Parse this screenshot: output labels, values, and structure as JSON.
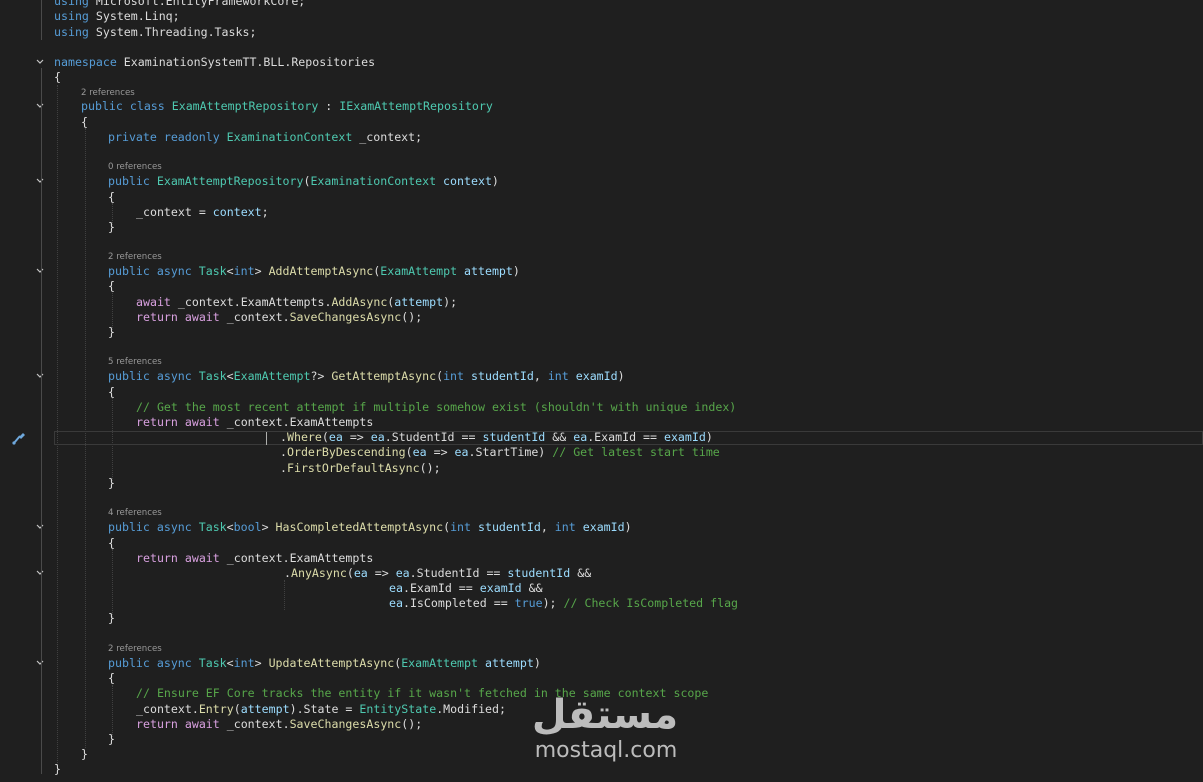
{
  "editor": {
    "theme": {
      "background": "#1f1f1f",
      "keyword": "#569cd6",
      "control": "#d8a0df",
      "type": "#4ec9b0",
      "method": "#dcdcaa",
      "parameter": "#9cdcfe",
      "comment": "#57a64a",
      "text": "#dcdcdc",
      "codelens": "#999999"
    },
    "code": {
      "using1": {
        "kw": "using",
        "ns": " Microsoft.EntityFrameworkCore;"
      },
      "using2": {
        "kw": "using",
        "ns": " System.Linq;"
      },
      "using3": {
        "kw": "using",
        "ns": " System.Threading.Tasks;"
      },
      "namespace": {
        "kw": "namespace",
        "name": " ExaminationSystemTT.BLL.Repositories"
      },
      "brace_open": "{",
      "brace_close": "}",
      "lens_class": "2 references",
      "class_decl": {
        "kw": "public class",
        "name": " ExamAttemptRepository",
        "sep": " : ",
        "iface": "IExamAttemptRepository"
      },
      "field": {
        "kw": "private readonly",
        "type": " ExaminationContext",
        "rest": " _context;"
      },
      "lens_ctor": "0 references",
      "ctor": {
        "kw": "public",
        "name": " ExamAttemptRepository",
        "open": "(",
        "ptype": "ExaminationContext",
        "pname": " context",
        "close": ")"
      },
      "ctor_body": {
        "lhs": "_context = ",
        "rhs": "context",
        "end": ";"
      },
      "lens_add": "2 references",
      "add_sig": {
        "kw": "public async",
        "task": " Task",
        "lt": "<",
        "generic": "int",
        "gt": "> ",
        "name": "AddAttemptAsync",
        "open": "(",
        "ptype": "ExamAttempt",
        "pname": " attempt",
        "close": ")"
      },
      "add_l1": {
        "kw": "await",
        "a": " _context.ExamAttempts.",
        "m": "AddAsync",
        "b": "(",
        "p": "attempt",
        "c": ");"
      },
      "add_l2": {
        "kw": "return await",
        "a": " _context.",
        "m": "SaveChangesAsync",
        "c": "();"
      },
      "lens_get": "5 references",
      "get_sig": {
        "kw": "public async",
        "task": " Task",
        "lt": "<",
        "generic": "ExamAttempt",
        "gt": "?> ",
        "name": "GetAttemptAsync",
        "open": "(",
        "t1": "int",
        "p1": " studentId",
        "comma": ", ",
        "t2": "int",
        "p2": " examId",
        "close": ")"
      },
      "get_comment": "// Get the most recent attempt if multiple somehow exist (shouldn't with unique index)",
      "get_l1": {
        "kw": "return await",
        "a": " _context.ExamAttempts"
      },
      "get_l2": {
        "dot": ".",
        "m": "Where",
        "a": "(",
        "p1": "ea",
        "b": " => ",
        "p2": "ea",
        "c": ".StudentId == ",
        "p3": "studentId",
        "d": " && ",
        "p4": "ea",
        "e": ".ExamId == ",
        "p5": "examId",
        "f": ")"
      },
      "get_l3": {
        "dot": ".",
        "m": "OrderByDescending",
        "a": "(",
        "p1": "ea",
        "b": " => ",
        "p2": "ea",
        "c": ".StartTime) ",
        "cm": "// Get latest start time"
      },
      "get_l4": {
        "dot": ".",
        "m": "FirstOrDefaultAsync",
        "c": "();"
      },
      "lens_has": "4 references",
      "has_sig": {
        "kw": "public async",
        "task": " Task",
        "lt": "<",
        "generic": "bool",
        "gt": "> ",
        "name": "HasCompletedAttemptAsync",
        "open": "(",
        "t1": "int",
        "p1": " studentId",
        "comma": ", ",
        "t2": "int",
        "p2": " examId",
        "close": ")"
      },
      "has_l1": {
        "kw": "return await",
        "a": " _context.ExamAttempts"
      },
      "has_l2": {
        "dot": ".",
        "m": "AnyAsync",
        "a": "(",
        "p1": "ea",
        "b": " => ",
        "p2": "ea",
        "c": ".StudentId == ",
        "p3": "studentId",
        "d": " &&"
      },
      "has_l3": {
        "p1": "ea",
        "c": ".ExamId == ",
        "p2": "examId",
        "d": " &&"
      },
      "has_l4": {
        "p1": "ea",
        "c": ".IsCompleted == ",
        "kw": "true",
        "d": "); ",
        "cm": "// Check IsCompleted flag"
      },
      "lens_upd": "2 references",
      "upd_sig": {
        "kw": "public async",
        "task": " Task",
        "lt": "<",
        "generic": "int",
        "gt": "> ",
        "name": "UpdateAttemptAsync",
        "open": "(",
        "ptype": "ExamAttempt",
        "pname": " attempt",
        "close": ")"
      },
      "upd_comment": "// Ensure EF Core tracks the entity if it wasn't fetched in the same context scope",
      "upd_l1": {
        "a": "_context.",
        "m": "Entry",
        "b": "(",
        "p": "attempt",
        "c": ").State = ",
        "t": "EntityState",
        "d": ".Modified;"
      },
      "upd_l2": {
        "kw": "return await",
        "a": " _context.",
        "m": "SaveChangesAsync",
        "c": "();"
      }
    }
  },
  "watermark": {
    "arabic": "مستقل",
    "latin": "mostaql.com"
  }
}
